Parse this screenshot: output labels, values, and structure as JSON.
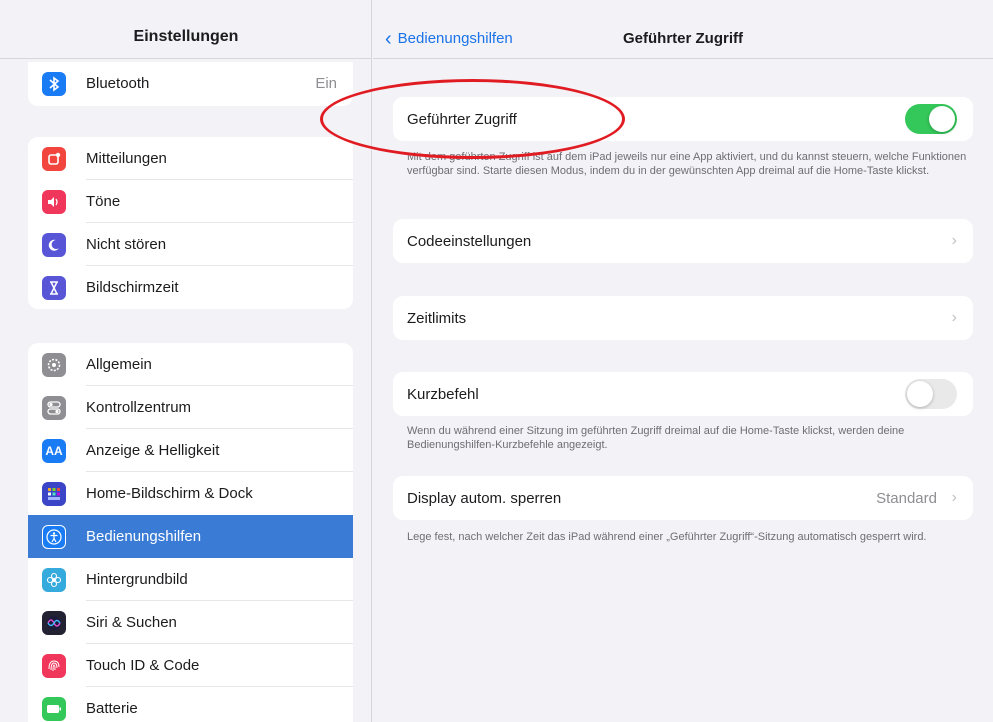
{
  "sidebar": {
    "title": "Einstellungen",
    "items": [
      {
        "label": "Bluetooth",
        "value": "Ein",
        "icon": "bluetooth-icon",
        "color": "#1a7cf5"
      },
      {
        "label": "Mitteilungen",
        "icon": "notifications-icon",
        "color": "#f1453d"
      },
      {
        "label": "Töne",
        "icon": "speaker-icon",
        "color": "#f0365a"
      },
      {
        "label": "Nicht stören",
        "icon": "moon-icon",
        "color": "#5856d6"
      },
      {
        "label": "Bildschirmzeit",
        "icon": "hourglass-icon",
        "color": "#5856d6"
      },
      {
        "label": "Allgemein",
        "icon": "gear-icon",
        "color": "#8e8e93"
      },
      {
        "label": "Kontrollzentrum",
        "icon": "toggles-icon",
        "color": "#8e8e93"
      },
      {
        "label": "Anzeige & Helligkeit",
        "icon": "text-size-icon",
        "color": "#1a7cf5"
      },
      {
        "label": "Home-Bildschirm & Dock",
        "icon": "grid-icon",
        "color": "#3a45c8"
      },
      {
        "label": "Bedienungshilfen",
        "icon": "accessibility-icon",
        "color": "#1a7cf5",
        "selected": true
      },
      {
        "label": "Hintergrundbild",
        "icon": "flower-icon",
        "color": "#35aadc"
      },
      {
        "label": "Siri & Suchen",
        "icon": "siri-icon",
        "color": "#222233"
      },
      {
        "label": "Touch ID & Code",
        "icon": "fingerprint-icon",
        "color": "#f0365a"
      },
      {
        "label": "Batterie",
        "icon": "battery-icon",
        "color": "#34c759"
      }
    ]
  },
  "detail": {
    "back_label": "Bedienungshilfen",
    "title": "Geführter Zugriff",
    "guided_access": {
      "label": "Geführter Zugriff",
      "enabled": true
    },
    "guided_access_note": "Mit dem geführten Zugriff ist auf dem iPad jeweils nur eine App aktiviert, und du kannst steuern, welche Funktionen verfügbar sind. Starte diesen Modus, indem du in der gewünschten App dreimal auf die Home-Taste klickst.",
    "passcode": {
      "label": "Codeeinstellungen"
    },
    "time_limits": {
      "label": "Zeitlimits"
    },
    "shortcut": {
      "label": "Kurzbefehl",
      "enabled": false
    },
    "shortcut_note": "Wenn du während einer Sitzung im geführten Zugriff dreimal auf die Home-Taste klickst, werden deine Bedienungshilfen-Kurzbefehle angezeigt.",
    "auto_lock": {
      "label": "Display autom. sperren",
      "value": "Standard"
    },
    "auto_lock_note": "Lege fest, nach welcher Zeit das iPad während einer „Geführter Zugriff“-Sitzung automatisch gesperrt wird."
  },
  "colors": {
    "accent": "#1a73e8",
    "selection": "#3a7bd5",
    "toggle_on": "#34c759",
    "highlight": "#e01b22"
  }
}
